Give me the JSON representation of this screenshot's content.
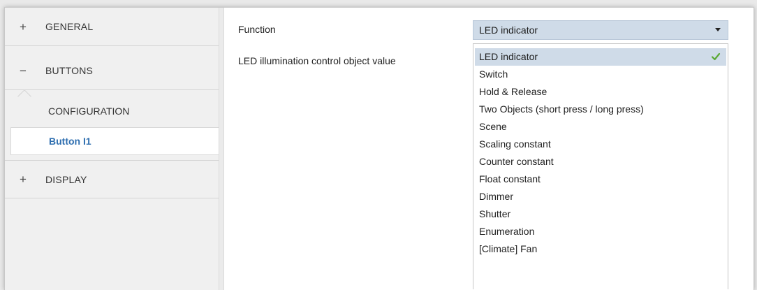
{
  "sidebar": {
    "general": {
      "sign": "+",
      "label": "GENERAL"
    },
    "buttons": {
      "sign": "−",
      "label": "BUTTONS"
    },
    "configuration": {
      "label": "CONFIGURATION"
    },
    "button_i1": {
      "label": "Button I1"
    },
    "display": {
      "sign": "+",
      "label": "DISPLAY"
    }
  },
  "main": {
    "function_label": "Function",
    "led_label": "LED illumination control object value",
    "function_select": {
      "selected": "LED indicator",
      "options": [
        "LED indicator",
        "Switch",
        "Hold & Release",
        "Two Objects (short press / long press)",
        "Scene",
        "Scaling constant",
        "Counter constant",
        "Float constant",
        "Dimmer",
        "Shutter",
        "Enumeration",
        "[Climate] Fan"
      ]
    }
  },
  "colors": {
    "accent_blue": "#2f6fb0",
    "selection": "#cfdbe8",
    "check_green": "#5aa832"
  },
  "icons": {
    "expand": "plus-icon",
    "collapse": "minus-icon",
    "dropdown": "caret-down-icon",
    "selected": "checkmark-icon"
  }
}
